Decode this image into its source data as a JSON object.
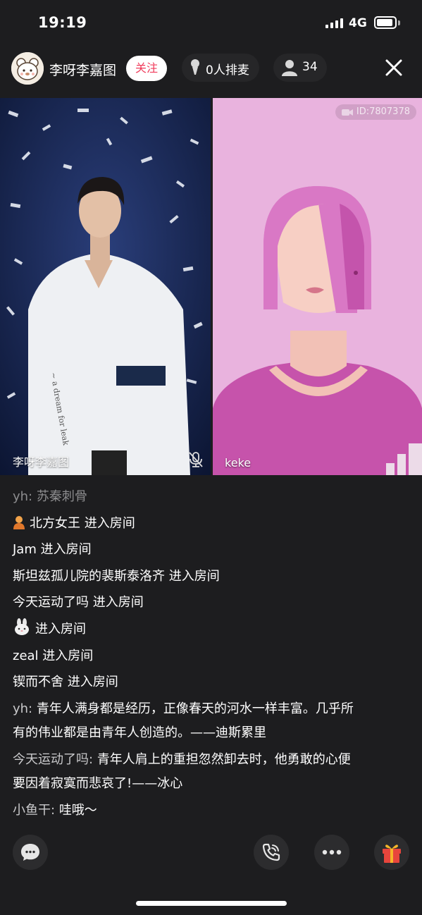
{
  "status_bar": {
    "time": "19:19",
    "network": "4G",
    "battery_level": 0.8
  },
  "header": {
    "host_name": "李呀李嘉图",
    "follow_label": "关注",
    "mic_queue_label": "0人排麦",
    "audience_count": "34"
  },
  "stage": {
    "left_seat_name": "李呀李嘉图",
    "right_seat_name": "keke",
    "room_id": "ID:7807378",
    "left_mic_muted": true
  },
  "chat": {
    "messages": [
      {
        "sender": "yh:",
        "text": "苏秦刺骨"
      },
      {
        "icon": "avatar-badge-icon",
        "text": "北方女王 进入房间"
      },
      {
        "text": "Jam 进入房间"
      },
      {
        "text": "斯坦兹孤儿院的裴斯泰洛齐 进入房间"
      },
      {
        "text": "今天运动了吗 进入房间"
      },
      {
        "icon": "rabbit-emoji-icon",
        "text": "进入房间"
      },
      {
        "text": "zeal 进入房间"
      },
      {
        "text": "锲而不舍 进入房间"
      },
      {
        "sender": "yh:",
        "text": "青年人满身都是经历，正像春天的河水一样丰富。几乎所有的伟业都是由青年人创造的。——迪斯累里"
      },
      {
        "sender": "今天运动了吗:",
        "text": "青年人肩上的重担忽然卸去时，他勇敢的心便要因着寂寞而悲哀了!——冰心"
      },
      {
        "sender": "小鱼干:",
        "text": "哇哦～"
      }
    ]
  },
  "colors": {
    "background": "#1d1d1f",
    "follow_text": "#f03b5b",
    "gift_red": "#e8453c",
    "gift_gold": "#f5b62a",
    "avatar_pink": "#d976c6"
  }
}
